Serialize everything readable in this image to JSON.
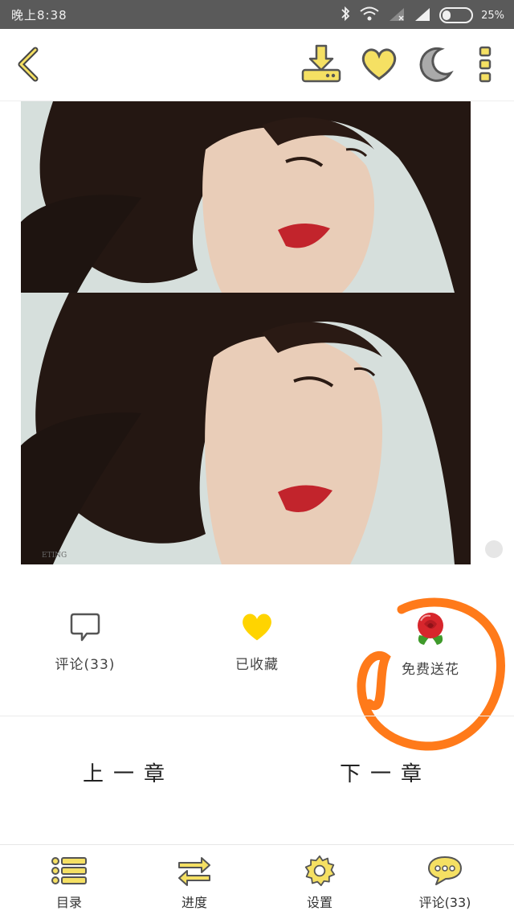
{
  "status_bar": {
    "time": "晚上8:38",
    "battery_pct": "25%"
  },
  "toolbar": {
    "back_icon": "chevron-left-icon",
    "download_icon": "download-icon",
    "favorite_icon": "heart-icon",
    "night_mode_icon": "moon-icon",
    "more_icon": "more-vertical-icon"
  },
  "content": {
    "watermark": "ETING"
  },
  "actions": {
    "comment_label": "评论(33)",
    "favorited_label": "已收藏",
    "free_flower_label": "免费送花"
  },
  "chapter_nav": {
    "prev_label": "上一章",
    "next_label": "下一章"
  },
  "bottom_nav": {
    "items": [
      {
        "label": "目录",
        "icon": "list-icon"
      },
      {
        "label": "进度",
        "icon": "progress-arrows-icon"
      },
      {
        "label": "设置",
        "icon": "gear-icon"
      },
      {
        "label": "评论(33)",
        "icon": "chat-bubble-icon"
      }
    ]
  },
  "colors": {
    "accent_yellow": "#f5e063",
    "icon_outline": "#555555",
    "annotation": "#ff7a1a"
  }
}
